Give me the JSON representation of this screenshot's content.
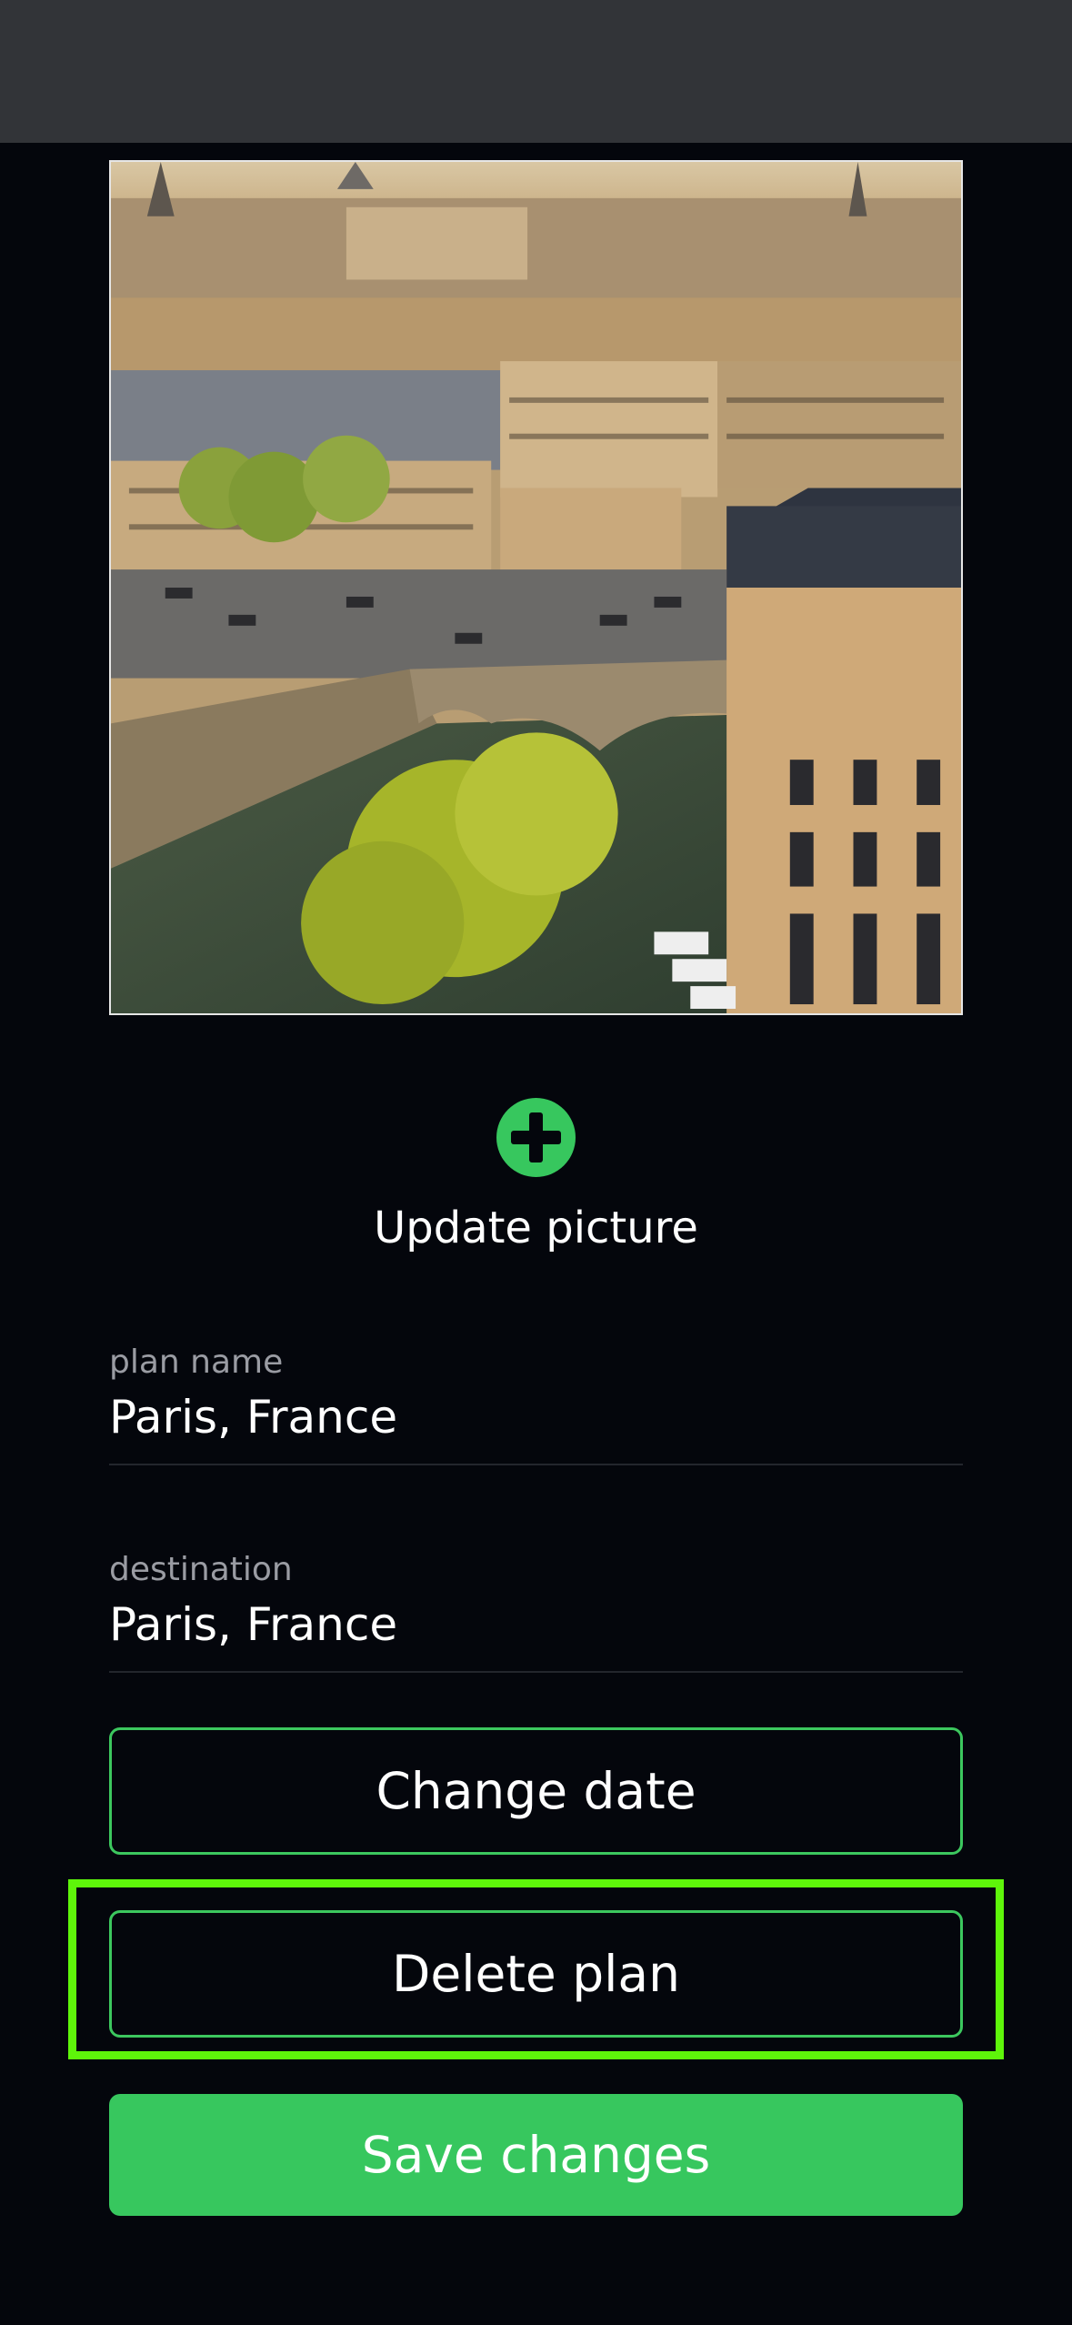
{
  "header": {
    "title": ""
  },
  "photo": {
    "alt_name": "paris-cityscape"
  },
  "update_picture": {
    "label": "Update picture",
    "icon": "plus-circle-icon"
  },
  "fields": {
    "plan_name": {
      "label": "plan name",
      "value": "Paris, France"
    },
    "destination": {
      "label": "destination",
      "value": "Paris, France"
    }
  },
  "buttons": {
    "change_date": "Change date",
    "delete_plan": "Delete plan",
    "save_changes": "Save changes"
  },
  "colors": {
    "accent": "#37c75e",
    "highlight": "#5ef50a",
    "background": "#04060c",
    "topbar": "#323438"
  }
}
